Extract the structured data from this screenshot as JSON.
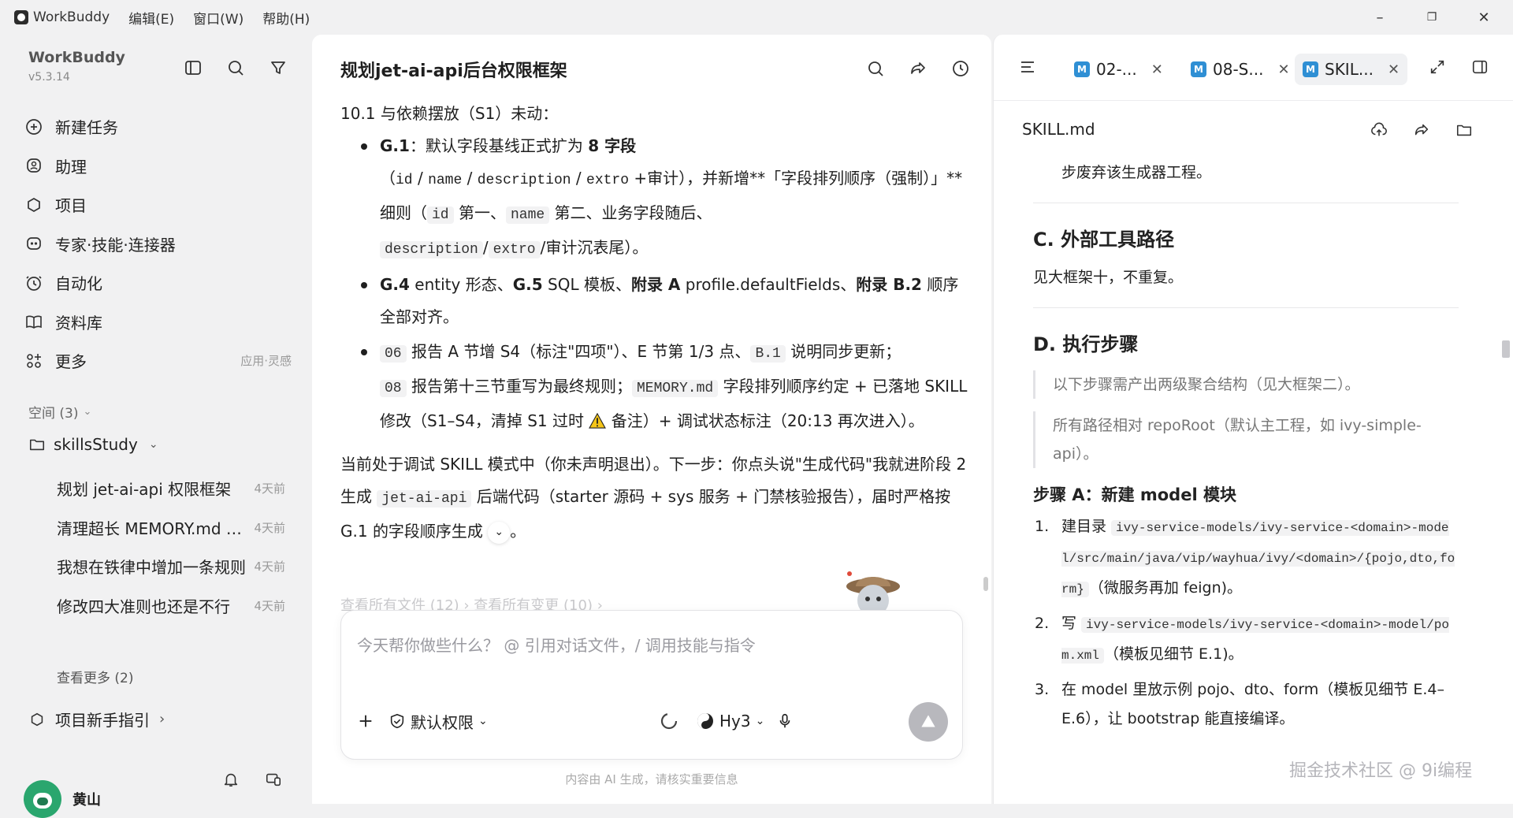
{
  "titlebar": {
    "app_name": "WorkBuddy",
    "menus": [
      "编辑(E)",
      "窗口(W)",
      "帮助(H)"
    ],
    "controls": {
      "minimize": "–",
      "restore": "❐",
      "close": "✕"
    }
  },
  "sidebar": {
    "brand": "WorkBuddy",
    "version": "v5.3.14",
    "nav": [
      {
        "label": "新建任务",
        "icon": "new-task-icon"
      },
      {
        "label": "助理",
        "icon": "assistant-icon"
      },
      {
        "label": "项目",
        "icon": "project-icon"
      },
      {
        "label": "专家·技能·连接器",
        "icon": "expert-icon"
      },
      {
        "label": "自动化",
        "icon": "automation-icon"
      },
      {
        "label": "资料库",
        "icon": "library-icon"
      },
      {
        "label": "更多",
        "icon": "more-icon",
        "extra": "应用·灵感"
      }
    ],
    "space_header": "空间 (3)",
    "folder": "skillsStudy",
    "tasks": [
      {
        "title": "规划 jet-ai-api 权限框架",
        "ago": "4天前"
      },
      {
        "title": "清理超长 MEMORY.md 文件",
        "ago": "4天前"
      },
      {
        "title": "我想在铁律中增加一条规则",
        "ago": "4天前"
      },
      {
        "title": "修改四大准则也还是不行",
        "ago": "4天前"
      }
    ],
    "see_more": "查看更多 (2)",
    "guide": "项目新手指引",
    "user_name": "黄山"
  },
  "main": {
    "title": "规划jet-ai-api后台权限框架",
    "section_heading": "10.1 与依赖摆放（S1）未动：",
    "bullet1": {
      "lead": "G.1",
      "lead_text": "：默认字段基线正式扩为 ",
      "bold_count": "8 字段",
      "open": "（",
      "codes": [
        "id",
        "name",
        "description",
        "extro"
      ],
      "after_codes": "+审计），并新增**「字段排列顺序（强制）」**细则（",
      "code_id": "id",
      "first": " 第一、",
      "code_name": "name",
      "second": " 第二、业务字段随后、",
      "code_desc": "description",
      "slash": "/",
      "code_extro": "extro",
      "tail": "/审计沉表尾）。"
    },
    "bullet2": {
      "g4": "G.4",
      "t1": " entity 形态、",
      "g5": "G.5",
      "t2": " SQL 模板、",
      "appA": "附录 A",
      "t3": " profile.defaultFields、",
      "appB": "附录 B.2",
      "t4": " 顺序全部对齐。"
    },
    "bullet3": {
      "code06": "06",
      "t1": " 报告 A 节增 S4（标注\"四项\"）、E 节第 1/3 点、",
      "codeB1": "B.1",
      "t2": " 说明同步更新；",
      "code08": "08",
      "t3": " 报告第十三节重写为最终规则；",
      "codeMem": "MEMORY.md",
      "t4": " 字段排列顺序约定 + 已落地 SKILL 修改（S1–S4，清掉 S1 过时 ",
      "t5": " 备注）+ 调试状态标注（20:13 再次进入）。"
    },
    "para": {
      "t1": "当前处于调试 SKILL 模式中（你未声明退出）。下一步：你点头说\"生成代码\"我就进阶段 2 生成 ",
      "code": "jet-ai-api",
      "t2": " 后端代码（starter 源码 + sys 服务 + 门禁核验报告），届时严格按 G.1 的字段顺序生成",
      "t3": "。"
    },
    "faded_links": "查看所有文件 (12)  ›    查看所有变更 (10)  ›",
    "input_placeholder": "今天帮你做些什么？ @ 引用对话文件，/ 调用技能与指令",
    "permission_label": "默认权限",
    "model_label": "Hy3",
    "disclaimer": "内容由 AI 生成，请核实重要信息"
  },
  "right": {
    "tabs": [
      {
        "label": "02-...",
        "active": false
      },
      {
        "label": "08-S...",
        "active": false
      },
      {
        "label": "SKIL...",
        "active": true
      }
    ],
    "doc_title": "SKILL.md",
    "top_text": "步废弃该生成器工程。",
    "sectionC": "C. 外部工具路径",
    "sectionC_text": "见大框架十，不重复。",
    "sectionD": "D. 执行步骤",
    "quote1": "以下步骤需产出两级聚合结构（见大框架二）。",
    "quote2": "所有路径相对 repoRoot（默认主工程，如 ivy-simple-api）。",
    "stepA": "步骤 A：新建 model 模块",
    "steps": [
      {
        "n": "1.",
        "pre": "建目录 ",
        "code": "ivy-service-models/ivy-service-<domain>-model/src/main/java/vip/wayhua/ivy/<domain>/{pojo,dto,form}",
        "post": "（微服务再加 feign)。"
      },
      {
        "n": "2.",
        "pre": "写 ",
        "code": "ivy-service-models/ivy-service-<domain>-model/pom.xml",
        "post": "（模板见细节 E.1)。"
      },
      {
        "n": "3.",
        "pre": "在 model 里放示例 pojo、dto、form（模板见细节 E.4–E.6），让 bootstrap 能直接编译。",
        "code": "",
        "post": ""
      }
    ],
    "watermark": "掘金技术社区 @ 9i编程"
  }
}
